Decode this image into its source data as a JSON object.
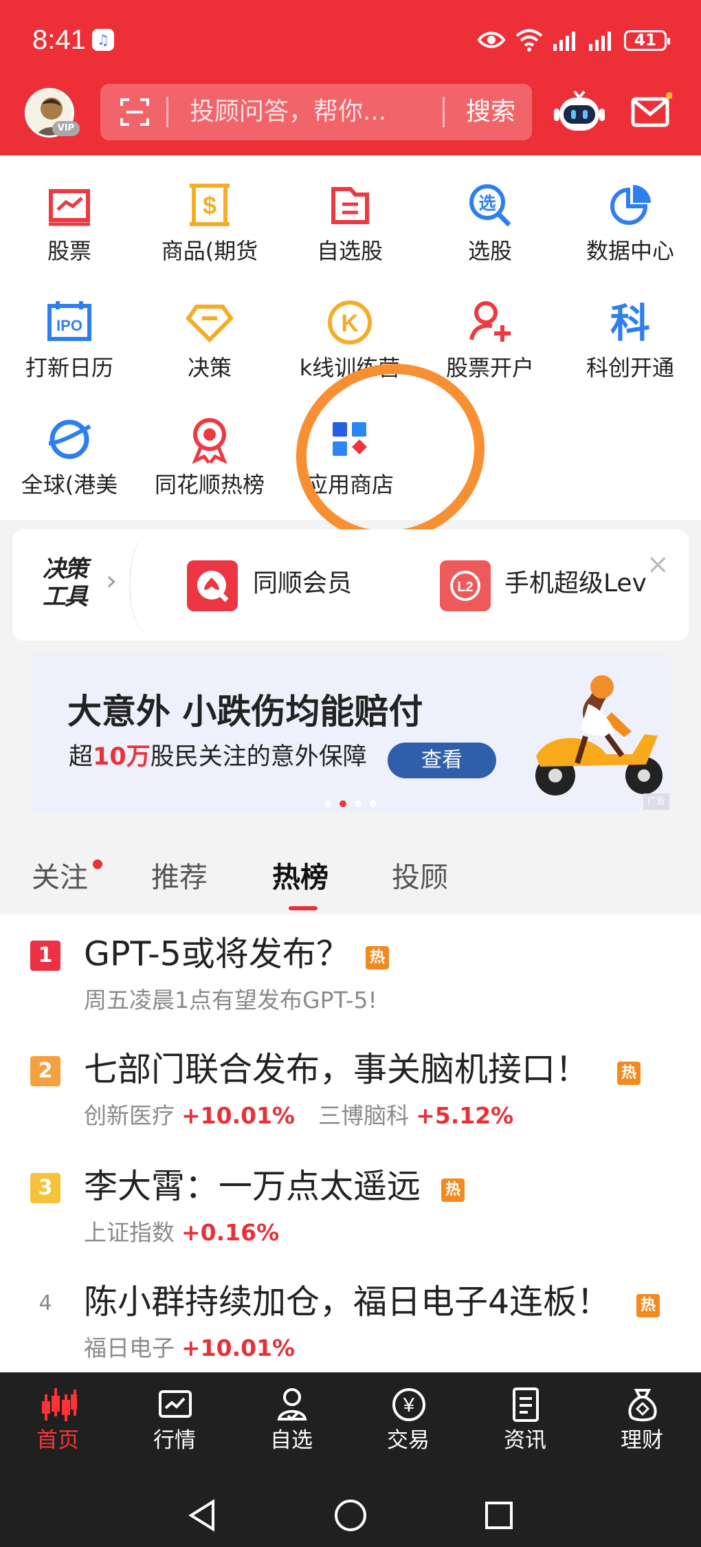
{
  "status": {
    "time": "8:41",
    "battery": "41"
  },
  "header": {
    "vip": "VIP",
    "search_placeholder": "投顾问答，帮你...",
    "search_button": "搜索"
  },
  "quick_menu": [
    {
      "label": "股票",
      "icon": "stock-chart-icon",
      "color": "#ed3941"
    },
    {
      "label": "商品(期货",
      "icon": "futures-dollar-icon",
      "color": "#f5ad28"
    },
    {
      "label": "自选股",
      "icon": "watchlist-folder-icon",
      "color": "#ed3941"
    },
    {
      "label": "选股",
      "icon": "stock-picker-search-icon",
      "color": "#2d7ff0"
    },
    {
      "label": "数据中心",
      "icon": "data-pie-icon",
      "color": "#2d7ff0"
    },
    {
      "label": "打新日历",
      "icon": "ipo-calendar-icon",
      "color": "#2d7ff0"
    },
    {
      "label": "决策",
      "icon": "decision-diamond-icon",
      "color": "#f5ad28"
    },
    {
      "label": "k线训练营",
      "icon": "kline-training-icon",
      "color": "#f5ad28"
    },
    {
      "label": "股票开户",
      "icon": "account-opening-icon",
      "color": "#ed3941"
    },
    {
      "label": "科创开通",
      "icon": "star-market-icon",
      "color": "#2d7ff0"
    },
    {
      "label": "全球(港美",
      "icon": "global-market-icon",
      "color": "#2d7ff0"
    },
    {
      "label": "同花顺热榜",
      "icon": "hot-rank-medal-icon",
      "color": "#ed3941"
    },
    {
      "label": "应用商店",
      "icon": "app-store-icon",
      "color": "#2d7ff0"
    }
  ],
  "decision_tools": {
    "title": "决策\n工具",
    "items": [
      {
        "label": "同顺会员",
        "icon": "member-icon"
      },
      {
        "label": "手机超级Lev",
        "icon": "level2-icon"
      }
    ]
  },
  "banner": {
    "title": "大意外 小跌伤均能赔付",
    "subtitle_prefix": "超",
    "subtitle_highlight": "10万",
    "subtitle_suffix": "股民关注的意外保障",
    "button": "查看",
    "ad": "广告"
  },
  "feed_tabs": [
    {
      "label": "关注"
    },
    {
      "label": "推荐"
    },
    {
      "label": "热榜",
      "active": true
    },
    {
      "label": "投顾"
    }
  ],
  "hot_list": [
    {
      "rank": "1",
      "title": "GPT-5或将发布？",
      "hot": "热",
      "subtitle": "周五凌晨1点有望发布GPT-5!"
    },
    {
      "rank": "2",
      "title": "七部门联合发布，事关脑机接口！",
      "hot": "热",
      "metrics": [
        {
          "name": "创新医疗",
          "value": "+10.01%"
        },
        {
          "name": "三博脑科",
          "value": "+5.12%"
        }
      ]
    },
    {
      "rank": "3",
      "title": "李大霄：一万点太遥远",
      "hot": "热",
      "metrics": [
        {
          "name": "上证指数",
          "value": "+0.16%"
        }
      ]
    },
    {
      "rank": "4",
      "title": "陈小群持续加仓，福日电子4连板！",
      "hot": "热",
      "metrics": [
        {
          "name": "福日电子",
          "value": "+10.01%"
        }
      ]
    }
  ],
  "bottom_nav": [
    {
      "label": "首页",
      "icon": "candlestick-home-icon",
      "active": true
    },
    {
      "label": "行情",
      "icon": "market-chart-icon"
    },
    {
      "label": "自选",
      "icon": "watchlist-person-icon"
    },
    {
      "label": "交易",
      "icon": "trade-yen-icon"
    },
    {
      "label": "资讯",
      "icon": "news-document-icon"
    },
    {
      "label": "理财",
      "icon": "wealth-bag-icon"
    }
  ],
  "colors": {
    "header_red": "#ed3038",
    "rank_red": "#ec3144",
    "rank_orange": "#f5a140",
    "rank_yellow": "#f6c23b",
    "hot_orange": "#f28a1f"
  }
}
